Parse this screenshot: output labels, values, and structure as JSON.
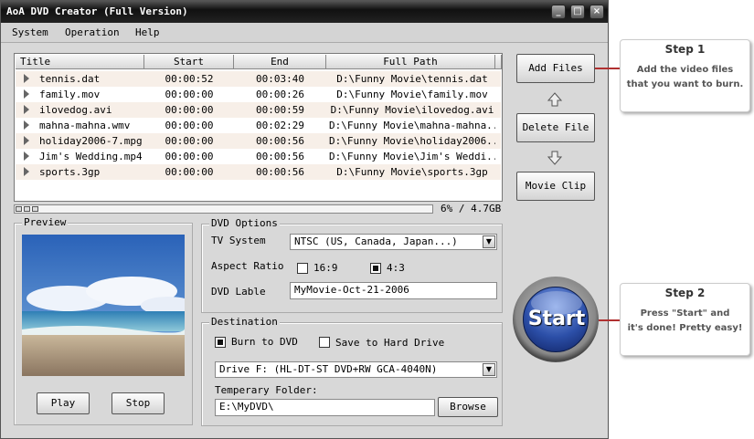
{
  "window": {
    "title": "AoA DVD Creator (Full Version)"
  },
  "menu": [
    "System",
    "Operation",
    "Help"
  ],
  "file_list": {
    "columns": [
      "Title",
      "Start",
      "End",
      "Full Path"
    ],
    "rows": [
      {
        "title": "tennis.dat",
        "start": "00:00:52",
        "end": "00:03:40",
        "path": "D:\\Funny Movie\\tennis.dat"
      },
      {
        "title": "family.mov",
        "start": "00:00:00",
        "end": "00:00:26",
        "path": "D:\\Funny Movie\\family.mov"
      },
      {
        "title": "ilovedog.avi",
        "start": "00:00:00",
        "end": "00:00:59",
        "path": "D:\\Funny Movie\\ilovedog.avi"
      },
      {
        "title": "mahna-mahna.wmv",
        "start": "00:00:00",
        "end": "00:02:29",
        "path": "D:\\Funny Movie\\mahna-mahna..."
      },
      {
        "title": "holiday2006-7.mpg",
        "start": "00:00:00",
        "end": "00:00:56",
        "path": "D:\\Funny Movie\\holiday2006..."
      },
      {
        "title": "Jim's Wedding.mp4",
        "start": "00:00:00",
        "end": "00:00:56",
        "path": "D:\\Funny Movie\\Jim's Weddi..."
      },
      {
        "title": "sports.3gp",
        "start": "00:00:00",
        "end": "00:00:56",
        "path": "D:\\Funny Movie\\sports.3gp"
      }
    ]
  },
  "usage": {
    "label": "6% / 4.7GB",
    "fraction": 0.06
  },
  "buttons": {
    "add_files": "Add Files",
    "delete_file": "Delete File",
    "movie_clip": "Movie Clip",
    "play": "Play",
    "stop": "Stop",
    "browse": "Browse",
    "start": "Start"
  },
  "preview": {
    "label": "Preview"
  },
  "dvd_options": {
    "label": "DVD Options",
    "tv_system_label": "TV System",
    "tv_system_value": "NTSC (US, Canada, Japan...)",
    "aspect_label": "Aspect Ratio",
    "aspect_16_9": "16:9",
    "aspect_4_3": "4:3",
    "dvd_label_label": "DVD Lable",
    "dvd_label_value": "MyMovie-Oct-21-2006"
  },
  "destination": {
    "label": "Destination",
    "burn_label": "Burn to DVD",
    "save_label": "Save to Hard Drive",
    "drive_value": "Drive F: (HL-DT-ST DVD+RW GCA-4040N)",
    "temp_label": "Temperary Folder:",
    "temp_value": "E:\\MyDVD\\"
  },
  "callouts": {
    "step1_title": "Step 1",
    "step1_line1": "Add the video files",
    "step1_line2": "that you want to burn.",
    "step2_title": "Step 2",
    "step2_line1": "Press \"Start\" and",
    "step2_line2": "it's done! Pretty easy!"
  },
  "colors": {
    "accent_red": "#b03030",
    "start_blue": "#2c4fa8"
  }
}
